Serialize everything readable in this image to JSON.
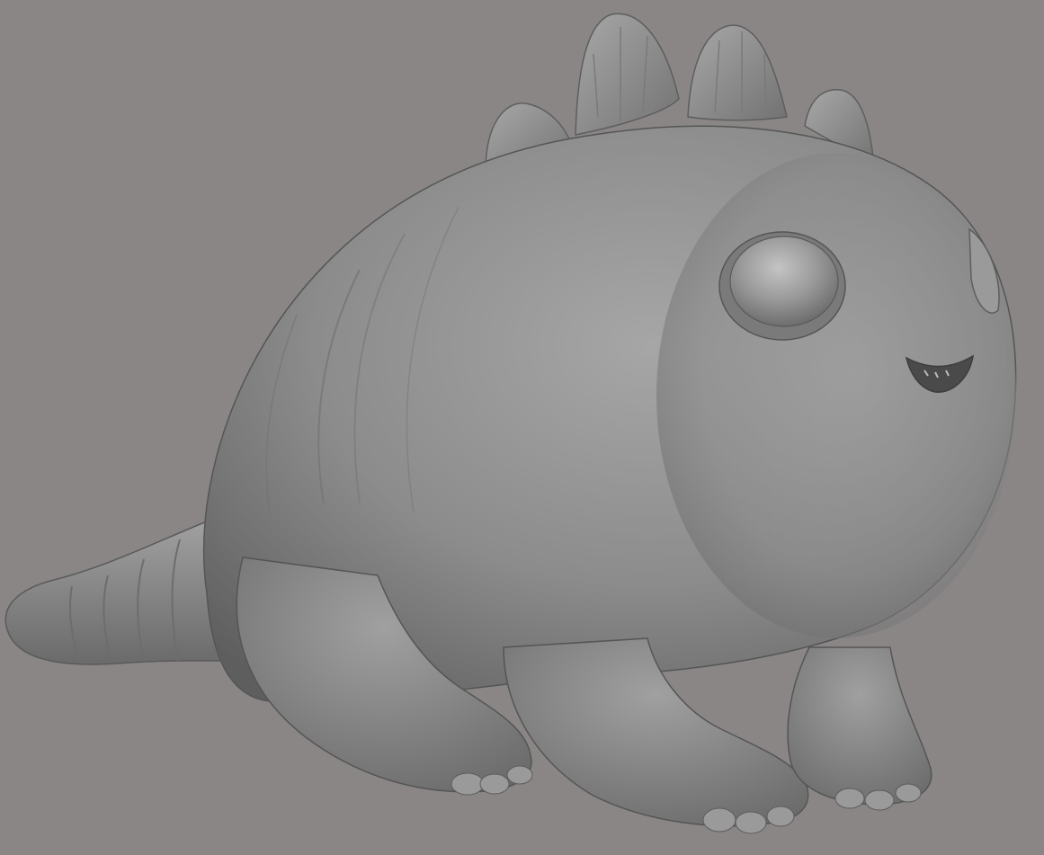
{
  "viewport": {
    "background_color": "#8a8686",
    "model_color": "#8f8f8f",
    "subject": "sculpted-creature-render"
  }
}
